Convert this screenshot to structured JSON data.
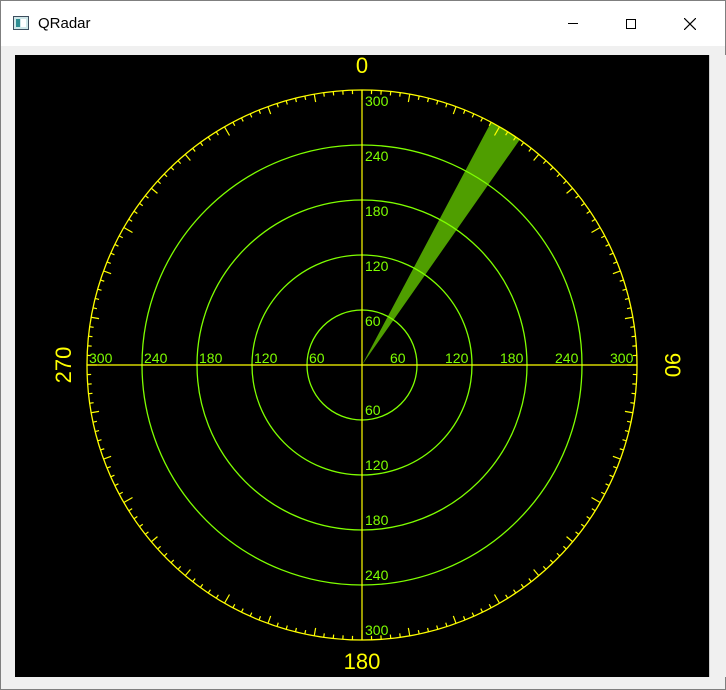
{
  "window": {
    "title": "QRadar"
  },
  "radar": {
    "background": "#000000",
    "ring_color": "#7fff00",
    "scale_color": "#ffff00",
    "sweep_color": "#4f9e00",
    "compass_labels": [
      "0",
      "90",
      "180",
      "270"
    ],
    "range_labels": [
      "60",
      "120",
      "180",
      "240",
      "300"
    ],
    "sweep_start_deg": 28,
    "sweep_end_deg": 35
  },
  "icons": {
    "app": "radar-app-icon",
    "minimize": "minimize-icon",
    "maximize": "maximize-icon",
    "close": "close-icon"
  }
}
